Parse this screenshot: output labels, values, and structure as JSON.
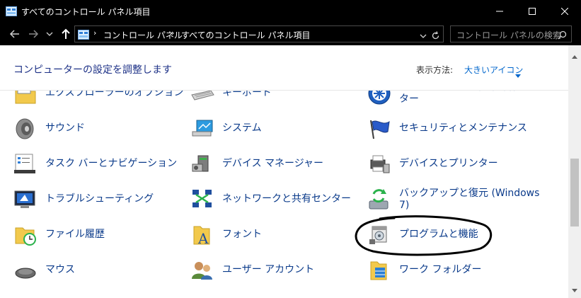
{
  "window": {
    "title": "すべてのコントロール パネル項目"
  },
  "address": {
    "breadcrumbs": [
      "コントロール パネル",
      "すべてのコントロール パネル項目"
    ],
    "search_placeholder": "コントロール パネルの検索"
  },
  "header": {
    "title": "コンピューターの設定を調整します",
    "view_by_label": "表示方法:",
    "view_by_value": "大きいアイコン"
  },
  "items": [
    {
      "label": "エクスプローラーのオプション",
      "icon": "folder-options-icon"
    },
    {
      "label": "キーボード",
      "icon": "keyboard-icon"
    },
    {
      "label": "コンピューターの簡単操作センター",
      "icon": "ease-of-access-icon"
    },
    {
      "label": "サウンド",
      "icon": "speaker-icon"
    },
    {
      "label": "システム",
      "icon": "system-icon"
    },
    {
      "label": "セキュリティとメンテナンス",
      "icon": "security-flag-icon"
    },
    {
      "label": "タスク バーとナビゲーション",
      "icon": "taskbar-icon"
    },
    {
      "label": "デバイス マネージャー",
      "icon": "device-manager-icon"
    },
    {
      "label": "デバイスとプリンター",
      "icon": "printer-icon"
    },
    {
      "label": "トラブルシューティング",
      "icon": "troubleshooting-icon"
    },
    {
      "label": "ネットワークと共有センター",
      "icon": "network-icon"
    },
    {
      "label": "バックアップと復元 (Windows 7)",
      "icon": "backup-restore-icon"
    },
    {
      "label": "ファイル履歴",
      "icon": "file-history-icon"
    },
    {
      "label": "フォント",
      "icon": "fonts-icon"
    },
    {
      "label": "プログラムと機能",
      "icon": "programs-features-icon"
    },
    {
      "label": "マウス",
      "icon": "mouse-icon"
    },
    {
      "label": "ユーザー アカウント",
      "icon": "user-accounts-icon"
    },
    {
      "label": "ワーク フォルダー",
      "icon": "work-folders-icon"
    }
  ],
  "colors": {
    "titlebar": "#000000",
    "link_text": "#0a3a8a",
    "accent": "#0066cc",
    "annotation": "#000000"
  }
}
